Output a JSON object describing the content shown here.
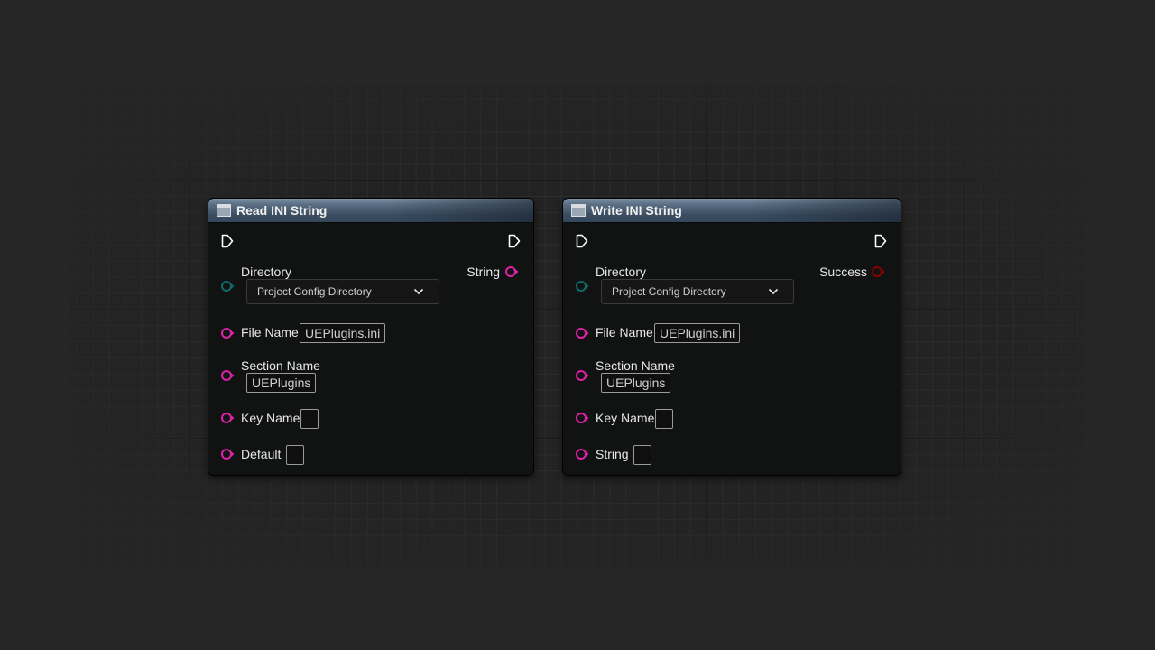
{
  "colors": {
    "string_pin": "#e020a8",
    "enum_pin": "#0f6b6b",
    "bool_pin": "#8a0000",
    "exec_pin": "#ffffff",
    "header": "#4a5d72"
  },
  "nodes": [
    {
      "title": "Read INI String",
      "icon": "function-icon",
      "inputs": {
        "directory": {
          "label": "Directory",
          "value": "Project Config Directory"
        },
        "file_name": {
          "label": "File Name",
          "value": "UEPlugins.ini"
        },
        "section_name": {
          "label": "Section Name",
          "value": "UEPlugins"
        },
        "key_name": {
          "label": "Key Name",
          "value": ""
        },
        "last": {
          "label": "Default",
          "value": ""
        }
      },
      "output": {
        "label": "String",
        "type": "string"
      }
    },
    {
      "title": "Write INI String",
      "icon": "function-icon",
      "inputs": {
        "directory": {
          "label": "Directory",
          "value": "Project Config Directory"
        },
        "file_name": {
          "label": "File Name",
          "value": "UEPlugins.ini"
        },
        "section_name": {
          "label": "Section Name",
          "value": "UEPlugins"
        },
        "key_name": {
          "label": "Key Name",
          "value": ""
        },
        "last": {
          "label": "String",
          "value": ""
        }
      },
      "output": {
        "label": "Success",
        "type": "bool"
      }
    }
  ]
}
